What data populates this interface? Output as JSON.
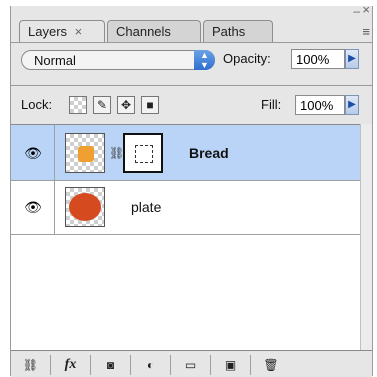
{
  "tabs": [
    {
      "label": "Layers",
      "close": "×"
    },
    {
      "label": "Channels"
    },
    {
      "label": "Paths"
    }
  ],
  "window": {
    "minimize": "–",
    "close": "×",
    "menu": "≡"
  },
  "blend_mode": {
    "value": "Normal",
    "arrow": "▲▼"
  },
  "opacity": {
    "label": "Opacity:",
    "value": "100%",
    "arrow": "▶"
  },
  "lock": {
    "label": "Lock:",
    "icons": [
      "transparent-pixels-icon",
      "brush-icon",
      "move-icon",
      "lock-icon"
    ]
  },
  "fill": {
    "label": "Fill:",
    "value": "100%",
    "arrow": "▶"
  },
  "layers": [
    {
      "name": "Bread",
      "selected": true,
      "visible": true
    },
    {
      "name": "plate",
      "selected": false,
      "visible": true
    }
  ],
  "bottom_buttons": [
    "link-layers-icon",
    "fx-icon",
    "add-mask-icon",
    "adjustment-layer-icon",
    "new-group-icon",
    "new-layer-icon",
    "delete-layer-icon"
  ],
  "bottom_labels": {
    "fx": "fx"
  },
  "colors": {
    "selected_row": "#b9d4f7",
    "accent": "#2f6fd0"
  }
}
